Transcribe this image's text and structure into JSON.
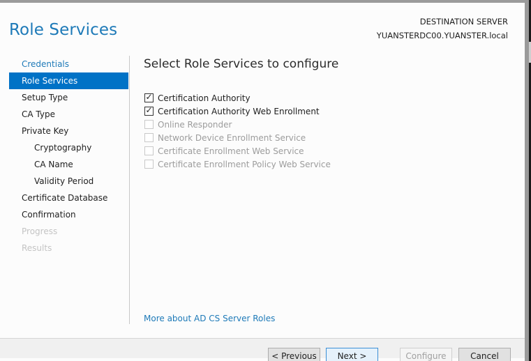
{
  "header": {
    "title": "Role Services",
    "destination_label": "DESTINATION SERVER",
    "destination_server": "YUANSTERDC00.YUANSTER.local"
  },
  "nav": {
    "items": [
      {
        "label": "Credentials",
        "state": "visited",
        "level": 0
      },
      {
        "label": "Role Services",
        "state": "active",
        "level": 0
      },
      {
        "label": "Setup Type",
        "state": "normal",
        "level": 0
      },
      {
        "label": "CA Type",
        "state": "normal",
        "level": 0
      },
      {
        "label": "Private Key",
        "state": "normal",
        "level": 0
      },
      {
        "label": "Cryptography",
        "state": "normal",
        "level": 1
      },
      {
        "label": "CA Name",
        "state": "normal",
        "level": 1
      },
      {
        "label": "Validity Period",
        "state": "normal",
        "level": 1
      },
      {
        "label": "Certificate Database",
        "state": "normal",
        "level": 0
      },
      {
        "label": "Confirmation",
        "state": "normal",
        "level": 0
      },
      {
        "label": "Progress",
        "state": "disabled",
        "level": 0
      },
      {
        "label": "Results",
        "state": "disabled",
        "level": 0
      }
    ]
  },
  "main": {
    "heading": "Select Role Services to configure",
    "options": [
      {
        "label": "Certification Authority",
        "checked": true,
        "enabled": true
      },
      {
        "label": "Certification Authority Web Enrollment",
        "checked": true,
        "enabled": true
      },
      {
        "label": "Online Responder",
        "checked": false,
        "enabled": false
      },
      {
        "label": "Network Device Enrollment Service",
        "checked": false,
        "enabled": false
      },
      {
        "label": "Certificate Enrollment Web Service",
        "checked": false,
        "enabled": false
      },
      {
        "label": "Certificate Enrollment Policy Web Service",
        "checked": false,
        "enabled": false
      }
    ],
    "more_link": "More about AD CS Server Roles"
  },
  "footer": {
    "previous_label": "< Previous",
    "next_label": "Next >",
    "configure_label": "Configure",
    "cancel_label": "Cancel"
  },
  "colors": {
    "accent": "#1e7ab8",
    "selected_bg": "#0072c6",
    "disabled_text": "#c4c4c4"
  }
}
